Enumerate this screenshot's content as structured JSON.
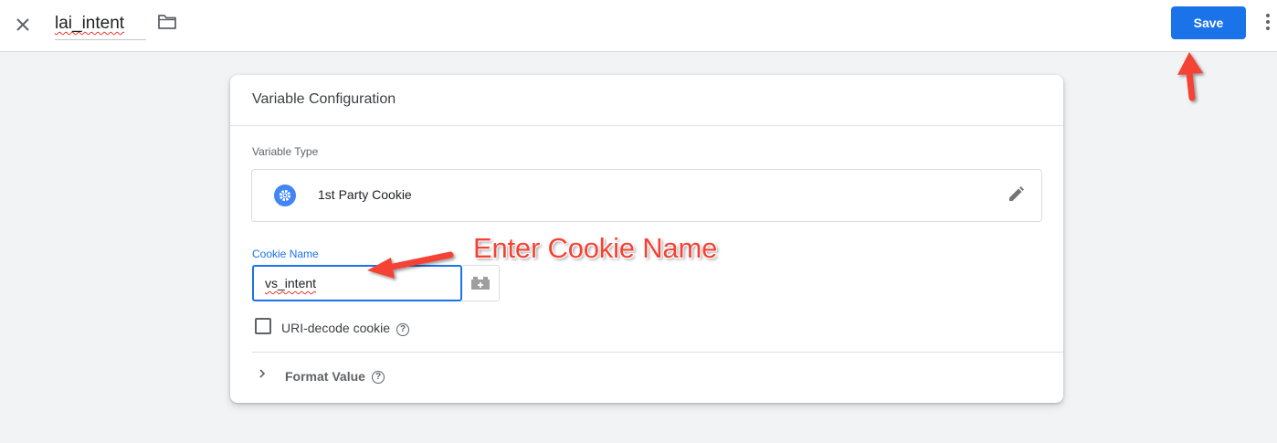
{
  "header": {
    "variable_name": "lai_intent",
    "save_label": "Save"
  },
  "card": {
    "title": "Variable Configuration",
    "variable_type_label": "Variable Type",
    "variable_type_name": "1st Party Cookie",
    "cookie_name_label": "Cookie Name",
    "cookie_name_value": "vs_intent",
    "uri_decode_label": "URI-decode cookie",
    "uri_decode_checked": false,
    "format_value_label": "Format Value"
  },
  "annotation": {
    "text": "Enter Cookie Name",
    "color": "#f44336"
  },
  "colors": {
    "accent": "#1a73e8",
    "type_icon": "#4285f4"
  },
  "icons": [
    "close-icon",
    "folder-icon",
    "more-vert-icon",
    "gear-icon",
    "pencil-icon",
    "variable-block-icon",
    "help-icon",
    "chevron-right-icon"
  ]
}
